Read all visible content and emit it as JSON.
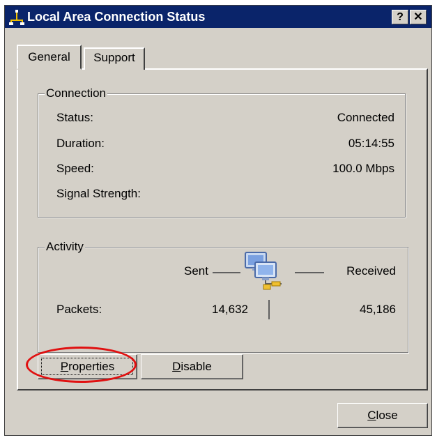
{
  "window": {
    "title": "Local Area Connection Status",
    "help_label": "?",
    "close_glyph": "✕",
    "title_icon": "network-connection-icon"
  },
  "tabs": [
    {
      "label": "General",
      "active": true
    },
    {
      "label": "Support",
      "active": false
    }
  ],
  "connection": {
    "legend": "Connection",
    "rows": [
      {
        "label": "Status:",
        "value": "Connected"
      },
      {
        "label": "Duration:",
        "value": "05:14:55"
      },
      {
        "label": "Speed:",
        "value": "100.0 Mbps"
      },
      {
        "label": "Signal Strength:",
        "value": ""
      }
    ]
  },
  "activity": {
    "legend": "Activity",
    "sent_label": "Sent",
    "received_label": "Received",
    "packets_label": "Packets:",
    "packets_sent": "14,632",
    "packets_received": "45,186",
    "icon": "network-activity-icon"
  },
  "buttons": {
    "properties": {
      "accel": "P",
      "rest": "roperties"
    },
    "disable": {
      "accel": "D",
      "rest": "isable"
    },
    "close": {
      "accel": "C",
      "rest": "lose"
    }
  },
  "colors": {
    "titlebar": "#0a246a",
    "dialog_face": "#d4d0c8",
    "highlight_ring": "#e01010"
  }
}
